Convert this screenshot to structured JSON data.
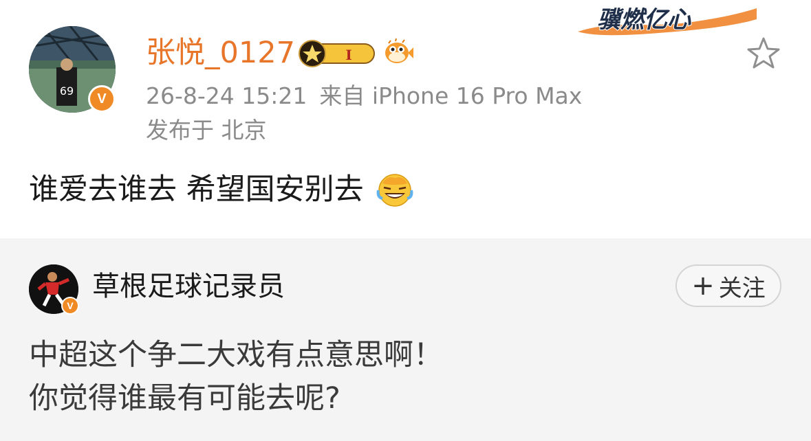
{
  "post": {
    "username": "张悦_0127",
    "level_badge": "I",
    "banner_text": "骥燃亿心",
    "timestamp": "26-8-24 15:21",
    "source": "来自 iPhone 16 Pro Max",
    "location": "发布于 北京",
    "content": "谁爱去谁去 希望国安别去",
    "verified_badge": "V"
  },
  "repost": {
    "author": "草根足球记录员",
    "verified_badge": "V",
    "follow_label": "关注",
    "follow_plus": "+",
    "lines": [
      "中超这个争二大戏有点意思啊！",
      "你觉得谁最有可能去呢?"
    ]
  },
  "colors": {
    "accent_orange": "#e8762a",
    "verified_orange": "#f08a25",
    "meta_gray": "#8a8a8a",
    "repost_bg": "#f4f4f4"
  },
  "icons": [
    "avatar",
    "verified-badge-icon",
    "level-badge-icon",
    "pufferfish-icon",
    "star-icon",
    "laughing-tears-emoji-icon"
  ]
}
